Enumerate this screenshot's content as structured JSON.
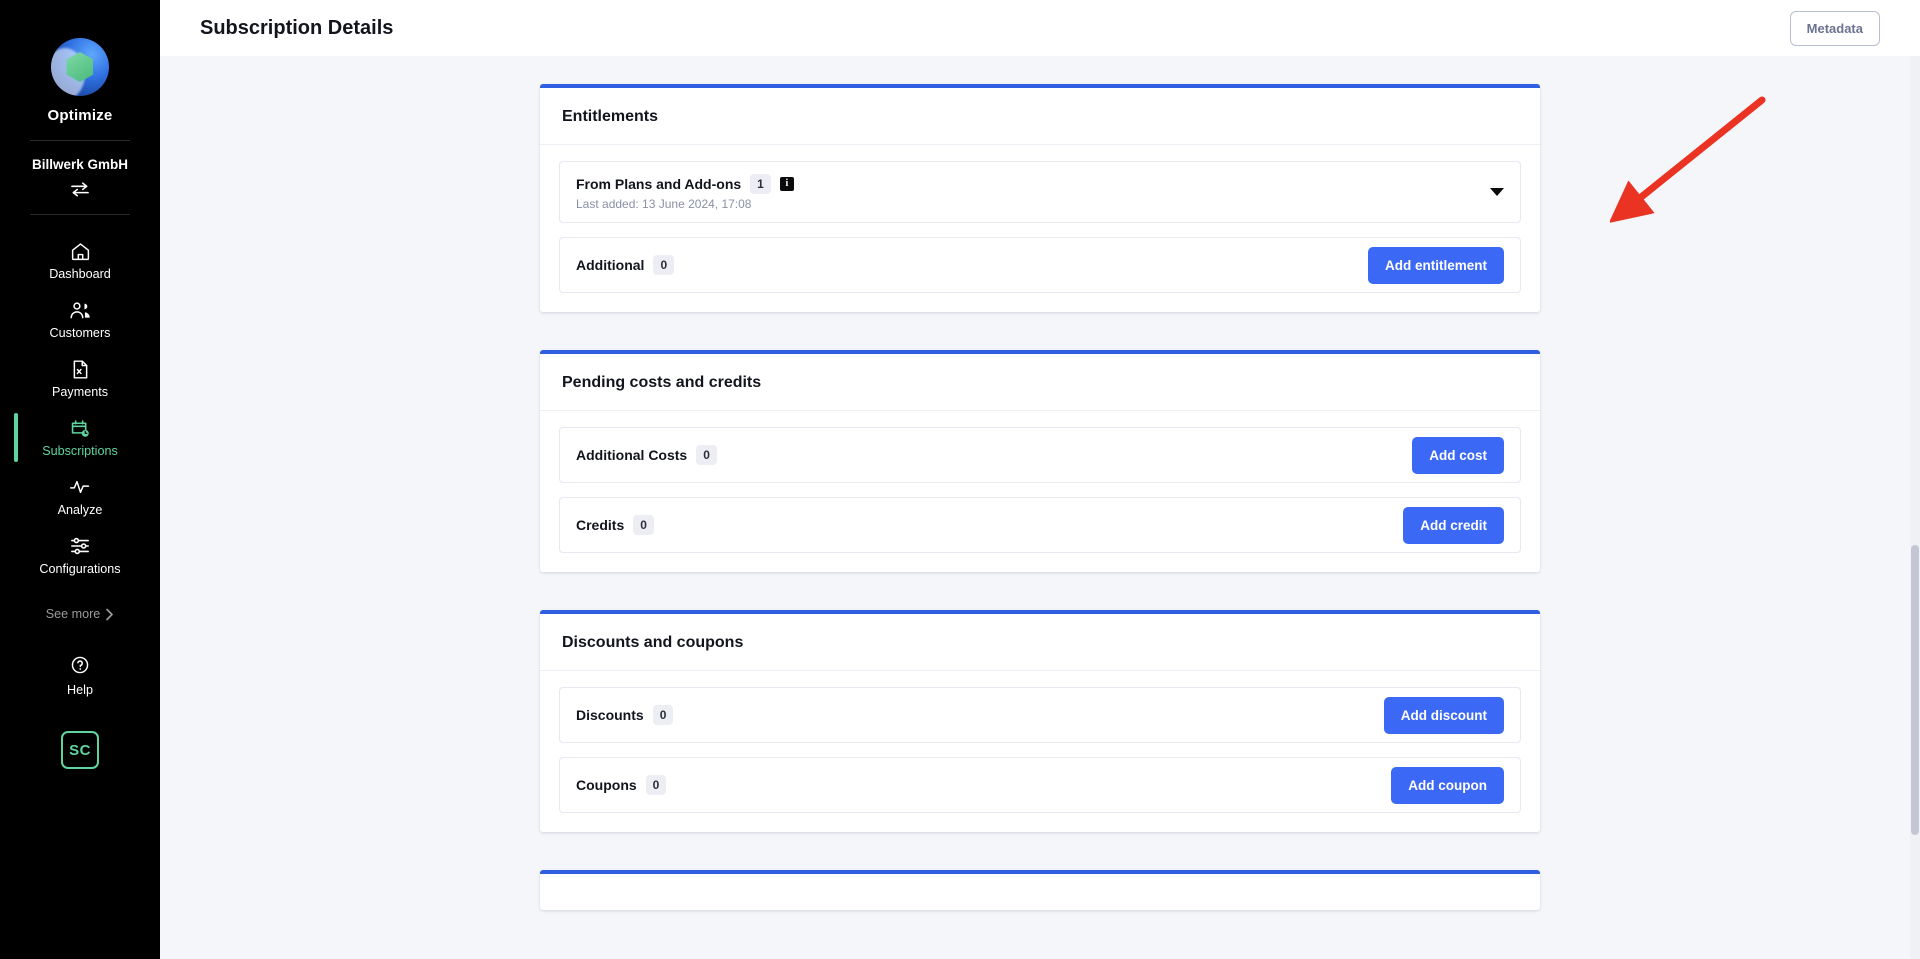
{
  "sidebar": {
    "product_name": "Optimize",
    "tenant_name": "Billwerk GmbH",
    "switch_icon": "switch-arrows-icon",
    "nav_items": [
      {
        "label": "Dashboard",
        "icon": "home-icon",
        "active": false
      },
      {
        "label": "Customers",
        "icon": "users-icon",
        "active": false
      },
      {
        "label": "Payments",
        "icon": "document-icon",
        "active": false
      },
      {
        "label": "Subscriptions",
        "icon": "calendar-clock-icon",
        "active": true
      },
      {
        "label": "Analyze",
        "icon": "pulse-icon",
        "active": false
      },
      {
        "label": "Configurations",
        "icon": "sliders-icon",
        "active": false
      }
    ],
    "see_more_label": "See more",
    "help_label": "Help",
    "avatar_initials": "SC",
    "accent_color": "#5ed4a0"
  },
  "header": {
    "title": "Subscription Details",
    "metadata_button": "Metadata"
  },
  "cards": [
    {
      "title": "Entitlements",
      "rows": [
        {
          "label": "From Plans and Add-ons",
          "count": "1",
          "info_badge": "i",
          "subtext": "Last added: 13 June 2024, 17:08",
          "control": "caret"
        },
        {
          "label": "Additional",
          "count": "0",
          "button": "Add entitlement"
        }
      ]
    },
    {
      "title": "Pending costs and credits",
      "rows": [
        {
          "label": "Additional Costs",
          "count": "0",
          "button": "Add cost"
        },
        {
          "label": "Credits",
          "count": "0",
          "button": "Add credit"
        }
      ]
    },
    {
      "title": "Discounts and coupons",
      "rows": [
        {
          "label": "Discounts",
          "count": "0",
          "button": "Add discount"
        },
        {
          "label": "Coupons",
          "count": "0",
          "button": "Add coupon"
        }
      ]
    }
  ],
  "annotation": {
    "arrow_color": "#ea3323",
    "points_to": "Add entitlement"
  },
  "theme": {
    "card_accent": "#2f5fe0",
    "primary_button": "#3b68f5",
    "page_background": "#f4f6fa"
  }
}
